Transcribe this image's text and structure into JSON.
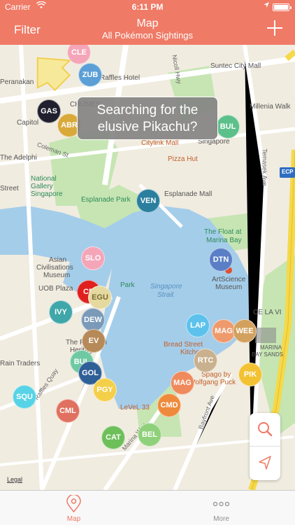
{
  "status": {
    "carrier": "Carrier",
    "time": "6:11 PM"
  },
  "nav": {
    "filter": "Filter",
    "title": "Map",
    "subtitle": "All Pokémon Sightings",
    "add_icon": "plus-icon"
  },
  "toast": {
    "line1": "Searching for the",
    "line2": "elusive Pikachu?"
  },
  "map_labels": {
    "raffles_hotel": "Raffles Hotel",
    "suntec": "Suntec City Mall",
    "millenia": "Millenia Walk",
    "nicoll": "Nicoll Hwy",
    "esplanade_park": "Esplanade Park",
    "esplanade_mall": "Esplanade Mall",
    "national_gallery": "National Gallery Singapore",
    "pizza_hut": "Pizza Hut",
    "citylink": "Citylink Mall",
    "float1": "The Float at",
    "float2": "Marina Bay",
    "strait1": "Singapore",
    "strait2": "Strait",
    "artscience1": "ArtScience",
    "artscience2": "Museum",
    "asian1": "Asian",
    "asian2": "Civilisations",
    "asian3": "Museum",
    "uob": "UOB Plaza",
    "park": "Park",
    "cela": "CE LA VI",
    "marina_bay_sands1": "MARINA",
    "marina_bay_sands2": "BAY SANDS",
    "bread_street": "Bread Street",
    "kitchen": "Kitchen",
    "spago1": "Spago by",
    "spago2": "Wolfgang Puck",
    "level33": "LeVeL 33",
    "raffles_quay": "Raffles Quay",
    "marina_way": "Marina Way",
    "bayfront": "Bayfront Ave",
    "temasek": "Temasek Ave",
    "coleman": "Coleman St",
    "capitol": "Capitol",
    "the_adelphi": "The Adelphi",
    "peranakan": "Peranakan",
    "ecp": "ECP",
    "legal": "Legal",
    "singapore": "Singapore",
    "rain_traders": "Rain Traders",
    "chimes": "CHIJMES",
    "street": "Street",
    "the_fullerton": "The Fullerton",
    "heritage": "Heritage"
  },
  "pokemon_pins": [
    {
      "code": "CLE",
      "color": "#f4a6b8"
    },
    {
      "code": "ZUB",
      "color": "#5b9fd6"
    },
    {
      "code": "GAS",
      "color": "#1f1f2e"
    },
    {
      "code": "ABR",
      "color": "#d9a93a"
    },
    {
      "code": "BUL",
      "color": "#5cc08a"
    },
    {
      "code": "VEN",
      "color": "#2a7f9e"
    },
    {
      "code": "DTN",
      "color": "#5b7fc6"
    },
    {
      "code": "SLO",
      "color": "#f4a6b8"
    },
    {
      "code": "CR",
      "color": "#e0201d"
    },
    {
      "code": "EGU",
      "color": "#e5d9a0"
    },
    {
      "code": "IVY",
      "color": "#3fa7a9"
    },
    {
      "code": "DEW",
      "color": "#7b9ab8"
    },
    {
      "code": "EV",
      "color": "#b68a58"
    },
    {
      "code": "BUL",
      "color": "#6ec9a2"
    },
    {
      "code": "GOL",
      "color": "#2f5f97"
    },
    {
      "code": "PGY",
      "color": "#f4cf4a"
    },
    {
      "code": "SQU",
      "color": "#56d3e6"
    },
    {
      "code": "CML",
      "color": "#e0705f"
    },
    {
      "code": "CAT",
      "color": "#6dbf5a"
    },
    {
      "code": "BEL",
      "color": "#8fd17a"
    },
    {
      "code": "CMD",
      "color": "#ef8a3c"
    },
    {
      "code": "MAG",
      "color": "#ef8a5c"
    },
    {
      "code": "RTC",
      "color": "#c9b08e"
    },
    {
      "code": "LAP",
      "color": "#5cc2ec"
    },
    {
      "code": "MAG",
      "color": "#ef9a6c"
    },
    {
      "code": "WEE",
      "color": "#d3a15e"
    },
    {
      "code": "PIK",
      "color": "#f2c233"
    }
  ],
  "map_buttons": {
    "search_icon": "search-icon",
    "locate_icon": "location-arrow-icon"
  },
  "tabs": [
    {
      "label": "Map",
      "icon": "map-pin-icon",
      "active": true
    },
    {
      "label": "More",
      "icon": "more-dots-icon",
      "active": false
    }
  ],
  "colors": {
    "accent": "#ef7a66",
    "water": "#a4cdea",
    "park": "#c6e5b3",
    "road": "#ffffff",
    "highway": "#f5d94a"
  }
}
